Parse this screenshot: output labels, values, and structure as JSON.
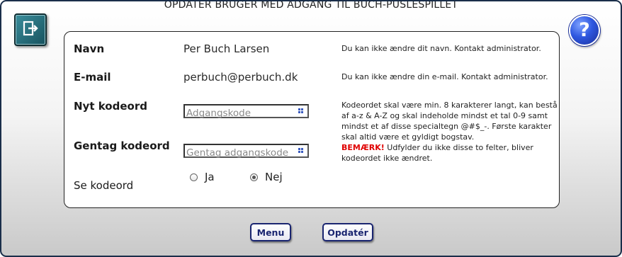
{
  "header": {
    "title": "OPDATER BRUGER MED ADGANG TIL BUCH-PUSLESPILLET",
    "exit_icon": "exit-icon",
    "help_label": "?"
  },
  "form": {
    "name": {
      "label": "Navn",
      "value": "Per Buch Larsen",
      "note": "Du kan ikke ændre dit navn. Kontakt administrator."
    },
    "email": {
      "label": "E-mail",
      "value": "perbuch@perbuch.dk",
      "note": "Du kan ikke ændre din e-mail. Kontakt administrator."
    },
    "new_password": {
      "label": "Nyt kodeord",
      "placeholder": "Adgangskode",
      "value": ""
    },
    "repeat_password": {
      "label": "Gentag kodeord",
      "placeholder": "Gentag adgangskode",
      "value": ""
    },
    "password_rules": [
      "Kodeordet skal være min. 8 karakterer langt, kan bestå",
      "af a-z & A-Z og skal indeholde mindst et tal 0-9 samt",
      "mindst et af disse specialtegn @#$_-. Første karakter",
      "skal altid være et gyldigt bogstav."
    ],
    "warning": {
      "emphasis": "BEMÆRK!",
      "text": " Udfylder du ikke disse to felter, bliver",
      "text2": "kodeordet ikke ændret."
    },
    "show_password": {
      "label": "Se kodeord",
      "options": [
        "Ja",
        "Nej"
      ],
      "selected": "Nej"
    }
  },
  "buttons": {
    "menu": "Menu",
    "update": "Opdatér"
  },
  "colors": {
    "button_border": "#1a2570",
    "warning": "#e00000",
    "help_blue": "#2f58e0",
    "exit_teal": "#2a7280"
  }
}
